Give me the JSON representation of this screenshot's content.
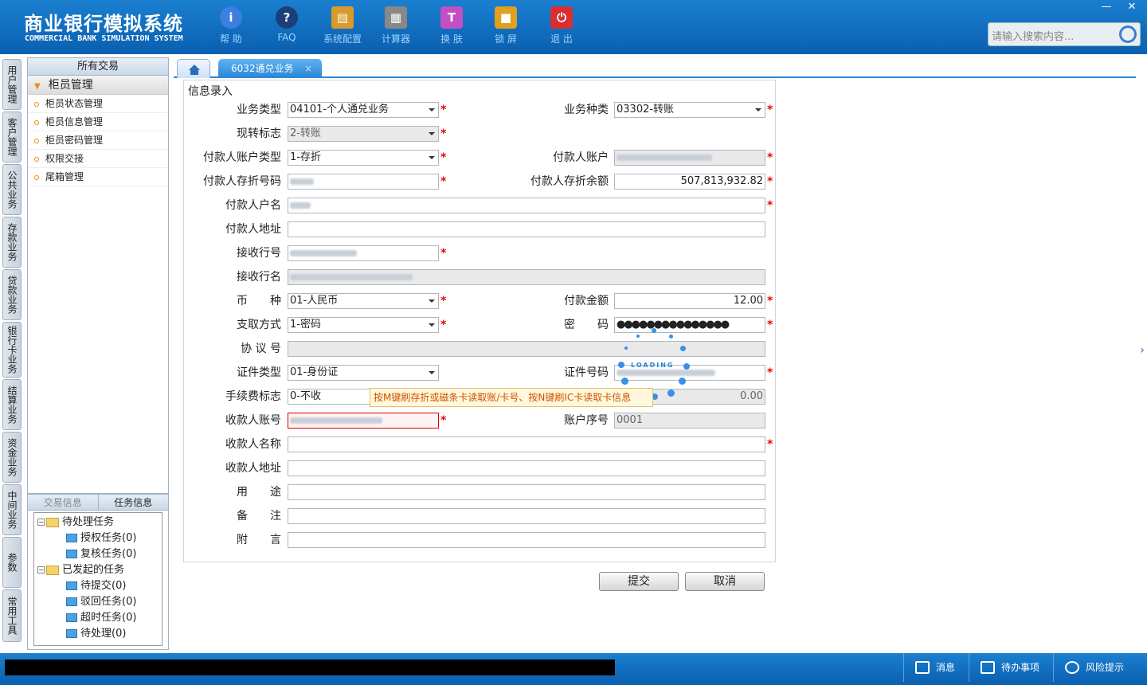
{
  "app": {
    "title_cn": "商业银行模拟系统",
    "title_en": "COMMERCIAL BANK SIMULATION SYSTEM"
  },
  "toolbar": [
    {
      "label": "帮 助",
      "icon": "info-icon",
      "color": "#3b7fe0"
    },
    {
      "label": "FAQ",
      "icon": "help-icon",
      "color": "#1a3f7a"
    },
    {
      "label": "系统配置",
      "icon": "toolbox-icon",
      "color": "#d89a2a"
    },
    {
      "label": "计算器",
      "icon": "calculator-icon",
      "color": "#888888"
    },
    {
      "label": "换 肤",
      "icon": "shirt-icon",
      "color": "#c44fc4"
    },
    {
      "label": "锁 屏",
      "icon": "lock-icon",
      "color": "#e0a020"
    },
    {
      "label": "退 出",
      "icon": "power-icon",
      "color": "#d83030"
    }
  ],
  "search": {
    "placeholder": "请输入搜索内容..."
  },
  "vertical_nav": [
    "用户管理",
    "客户管理",
    "公共业务",
    "存款业务",
    "贷款业务",
    "银行卡业务",
    "结算业务",
    "资金业务",
    "中间业务",
    "参数",
    "常用工具"
  ],
  "sidebar": {
    "header": "所有交易",
    "group": "柜员管理",
    "items": [
      "柜员状态管理",
      "柜员信息管理",
      "柜员密码管理",
      "权限交接",
      "尾箱管理"
    ]
  },
  "tasks": {
    "tabs": [
      "交易信息",
      "任务信息"
    ],
    "tree": [
      {
        "label": "待处理任务",
        "children": [
          "授权任务(0)",
          "复核任务(0)"
        ]
      },
      {
        "label": "已发起的任务",
        "children": [
          "待提交(0)",
          "驳回任务(0)",
          "超时任务(0)",
          "待处理(0)"
        ]
      }
    ]
  },
  "tabs": {
    "active": "6032通兑业务",
    "close": "×"
  },
  "form": {
    "legend": "信息录入",
    "biz_type": {
      "label": "业务类型",
      "value": "04101-个人通兑业务"
    },
    "biz_kind": {
      "label": "业务种类",
      "value": "03302-转账"
    },
    "cash_flag": {
      "label": "现转标志",
      "value": "2-转账"
    },
    "payer_acct_type": {
      "label": "付款人账户类型",
      "value": "1-存折"
    },
    "payer_acct": {
      "label": "付款人账户"
    },
    "payer_book_no": {
      "label": "付款人存折号码"
    },
    "payer_balance": {
      "label": "付款人存折余额",
      "value": "507,813,932.82"
    },
    "payer_name": {
      "label": "付款人户名"
    },
    "payer_addr": {
      "label": "付款人地址"
    },
    "recv_bank_no": {
      "label": "接收行号"
    },
    "recv_bank_name": {
      "label": "接收行名"
    },
    "currency": {
      "label": "币　　种",
      "value": "01-人民币"
    },
    "pay_amount": {
      "label": "付款金额",
      "value": "12.00"
    },
    "withdraw_mode": {
      "label": "支取方式",
      "value": "1-密码"
    },
    "password": {
      "label": "密　　码",
      "value": "●●●●●●●●●●●●●●●"
    },
    "agreement_no": {
      "label": "协 议 号"
    },
    "id_type": {
      "label": "证件类型",
      "value": "01-身份证"
    },
    "id_no": {
      "label": "证件号码"
    },
    "fee_flag": {
      "label": "手续费标志",
      "value": "0-不收"
    },
    "fee_amount": {
      "value": "0.00"
    },
    "payee_acct": {
      "label": "收款人账号"
    },
    "seq_no": {
      "label": "账户序号",
      "value": "0001"
    },
    "payee_name": {
      "label": "收款人名称"
    },
    "payee_addr": {
      "label": "收款人地址"
    },
    "purpose": {
      "label": "用　　途"
    },
    "remark": {
      "label": "备　　注"
    },
    "postscript": {
      "label": "附　　言"
    },
    "tooltip": "按M键刷存折或磁条卡读取账/卡号、按N键刷IC卡读取卡信息",
    "loading": "LOADING",
    "submit": "提交",
    "cancel": "取消"
  },
  "footer": {
    "messages": "消息",
    "todo": "待办事项",
    "risk": "风险提示"
  }
}
